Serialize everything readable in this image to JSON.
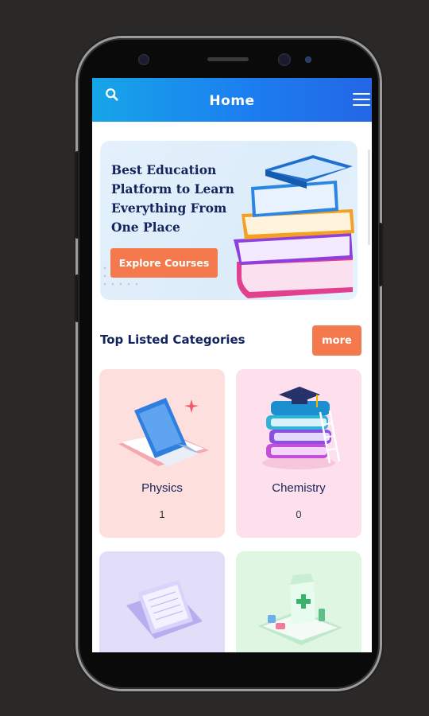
{
  "header": {
    "title": "Home",
    "search_icon": "search-icon",
    "menu_icon": "hamburger-menu-icon",
    "gradient_start": "#16a6e8",
    "gradient_end": "#2466e6"
  },
  "hero": {
    "heading_lines": [
      "Best Education",
      "Platform to Learn",
      "Everything From",
      "One Place"
    ],
    "button_label": "Explore Courses",
    "button_color": "#f47a4e"
  },
  "categories_section": {
    "title": "Top Listed Categories",
    "more_label": "more"
  },
  "categories": [
    {
      "name": "Physics",
      "count": "1",
      "bg": "#fde0dd"
    },
    {
      "name": "Chemistry",
      "count": "0",
      "bg": "#fde0ec"
    },
    {
      "name": "",
      "count": "",
      "bg": "#e2def9"
    },
    {
      "name": "",
      "count": "",
      "bg": "#def6e2"
    }
  ]
}
